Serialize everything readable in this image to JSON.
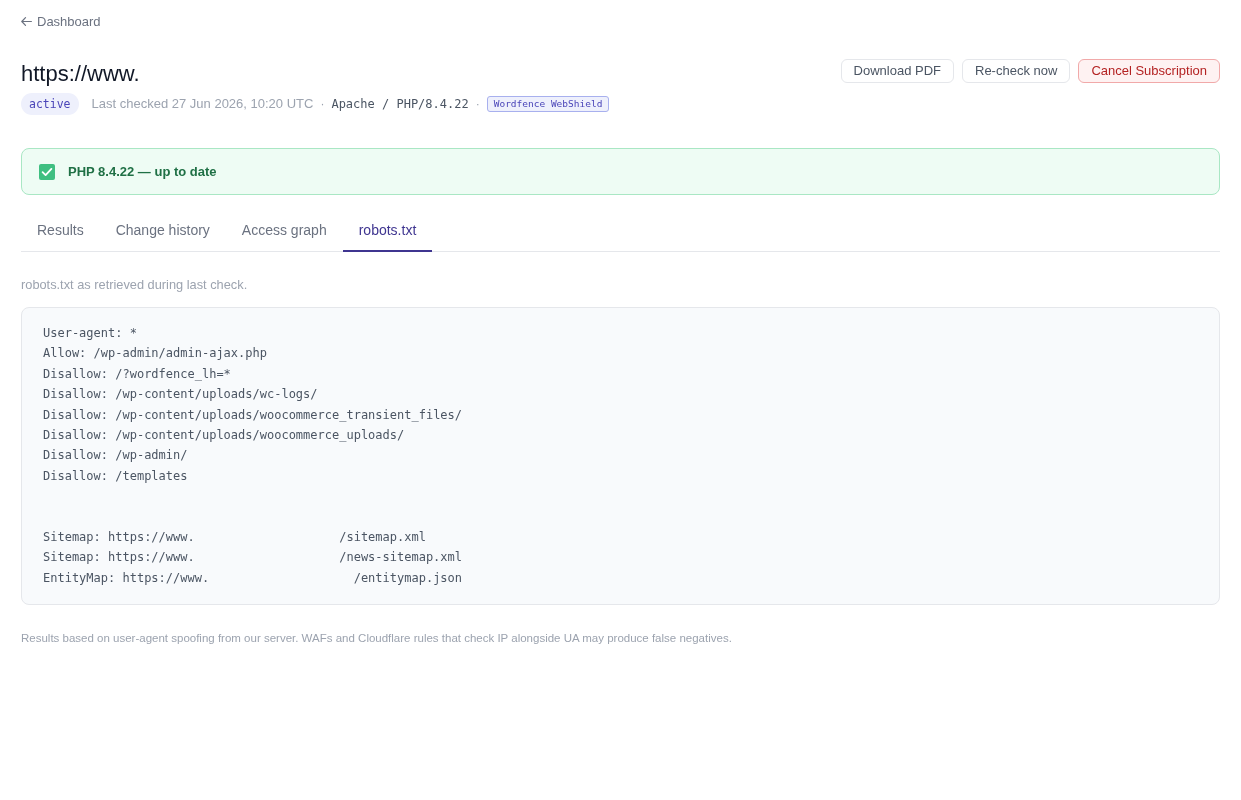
{
  "back_link": {
    "label": "Dashboard"
  },
  "header": {
    "title": "https://www.",
    "meta": [
      {
        "kind": "status",
        "text": "active"
      },
      {
        "kind": "text",
        "text": "Last checked 27 Jun 2026, 10:20 UTC"
      },
      {
        "kind": "separator",
        "text": "·"
      },
      {
        "kind": "mono",
        "text": "Apache / PHP/8.4.22"
      },
      {
        "kind": "separator",
        "text": "·"
      },
      {
        "kind": "tag",
        "text": "Wordfence WebShield"
      }
    ],
    "actions": [
      {
        "kind": "default",
        "label": "Download PDF"
      },
      {
        "kind": "default",
        "label": "Re-check now"
      },
      {
        "kind": "danger",
        "label": "Cancel Subscription"
      }
    ]
  },
  "alert": {
    "kind": "success",
    "message": "PHP 8.4.22 — up to date"
  },
  "tabs": [
    {
      "label": "Results",
      "selected": false
    },
    {
      "label": "Change history",
      "selected": false
    },
    {
      "label": "Access graph",
      "selected": false
    },
    {
      "label": "robots.txt",
      "selected": true
    }
  ],
  "robots_txt": {
    "caption": "robots.txt as retrieved during last check.",
    "sections": [
      {
        "lines": [
          {
            "text": "User-agent: *"
          },
          {
            "text": "Allow: /wp-admin/admin-ajax.php"
          },
          {
            "text": "Disallow: /?wordfence_lh=*"
          },
          {
            "text": "Disallow: /wp-content/uploads/wc-logs/"
          },
          {
            "text": "Disallow: /wp-content/uploads/woocommerce_transient_files/"
          },
          {
            "text": "Disallow: /wp-content/uploads/woocommerce_uploads/"
          },
          {
            "text": "Disallow: /wp-admin/"
          },
          {
            "text": "Disallow: /templates"
          }
        ]
      },
      {
        "lines": [
          {
            "text": "Sitemap: https://www.",
            "path": "/sitemap.xml"
          },
          {
            "text": "Sitemap: https://www.",
            "path": "/news-sitemap.xml"
          },
          {
            "text": "EntityMap: https://www.",
            "path": "/entitymap.json"
          }
        ]
      }
    ]
  },
  "footnote": "Results based on user-agent spoofing from our server. WAFs and Cloudflare rules that check IP alongside UA may produce false negatives."
}
